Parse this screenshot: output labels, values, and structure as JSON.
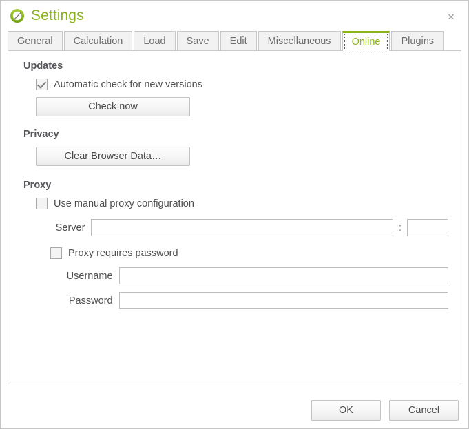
{
  "window": {
    "title": "Settings",
    "logo_icon": "green-circle-pen-icon",
    "close_icon": "×",
    "accent_color": "#8cb51a"
  },
  "tabs": [
    {
      "label": "General",
      "active": false
    },
    {
      "label": "Calculation",
      "active": false
    },
    {
      "label": "Load",
      "active": false
    },
    {
      "label": "Save",
      "active": false
    },
    {
      "label": "Edit",
      "active": false
    },
    {
      "label": "Miscellaneous",
      "active": false
    },
    {
      "label": "Online",
      "active": true
    },
    {
      "label": "Plugins",
      "active": false
    }
  ],
  "sections": {
    "updates": {
      "header": "Updates",
      "auto_check": {
        "label": "Automatic check for new versions",
        "checked": true
      },
      "check_now_label": "Check now"
    },
    "privacy": {
      "header": "Privacy",
      "clear_data_label": "Clear Browser Data…"
    },
    "proxy": {
      "header": "Proxy",
      "use_manual": {
        "label": "Use manual proxy configuration",
        "checked": false
      },
      "server_label": "Server",
      "server_value": "",
      "server_placeholder": "",
      "colon": ":",
      "port_value": "",
      "port_placeholder": "",
      "requires_password": {
        "label": "Proxy requires password",
        "checked": false
      },
      "username_label": "Username",
      "username_value": "",
      "username_placeholder": "",
      "password_label": "Password",
      "password_value": "",
      "password_placeholder": ""
    }
  },
  "footer": {
    "ok_label": "OK",
    "cancel_label": "Cancel"
  }
}
